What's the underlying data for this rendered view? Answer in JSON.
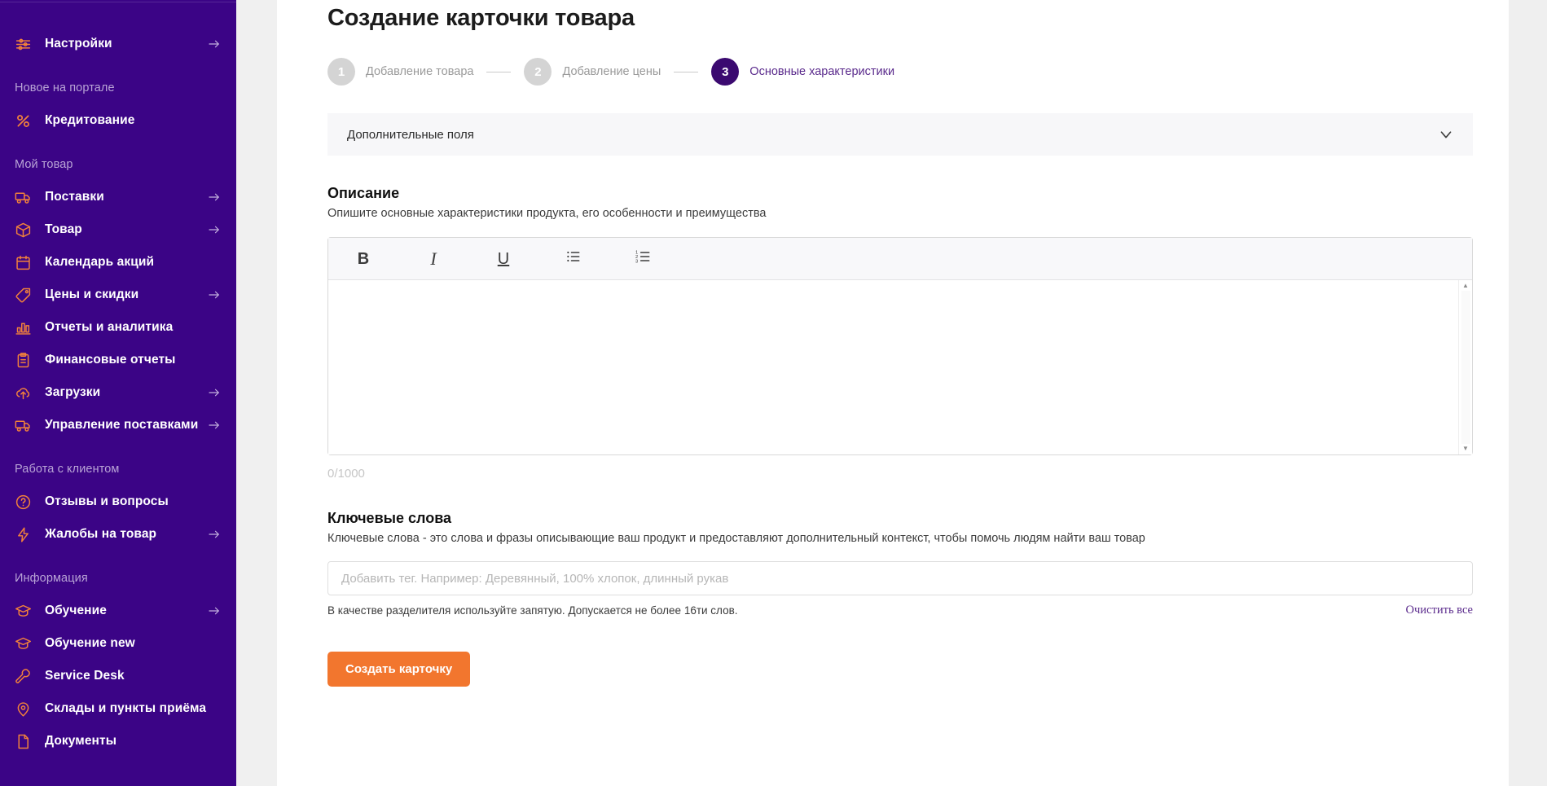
{
  "sidebar": {
    "groups": [
      {
        "title": "",
        "items": [
          {
            "label": "Настройки",
            "icon": "sliders-icon",
            "arrow": true
          }
        ]
      },
      {
        "title": "Новое на портале",
        "items": [
          {
            "label": "Кредитование",
            "icon": "percent-icon",
            "arrow": false
          }
        ]
      },
      {
        "title": "Мой товар",
        "items": [
          {
            "label": "Поставки",
            "icon": "truck-icon",
            "arrow": true
          },
          {
            "label": "Товар",
            "icon": "box-icon",
            "arrow": true
          },
          {
            "label": "Календарь акций",
            "icon": "calendar-icon",
            "arrow": false
          },
          {
            "label": "Цены и скидки",
            "icon": "tag-icon",
            "arrow": true
          },
          {
            "label": "Отчеты и аналитика",
            "icon": "bar-chart-icon",
            "arrow": false
          },
          {
            "label": "Финансовые отчеты",
            "icon": "clipboard-icon",
            "arrow": false
          },
          {
            "label": "Загрузки",
            "icon": "cloud-upload-icon",
            "arrow": true
          },
          {
            "label": "Управление поставками",
            "icon": "truck-icon",
            "arrow": true
          }
        ]
      },
      {
        "title": "Работа с клиентом",
        "items": [
          {
            "label": "Отзывы и вопросы",
            "icon": "question-circle-icon",
            "arrow": false
          },
          {
            "label": "Жалобы на товар",
            "icon": "bolt-icon",
            "arrow": true
          }
        ]
      },
      {
        "title": "Информация",
        "items": [
          {
            "label": "Обучение",
            "icon": "graduation-cap-icon",
            "arrow": true
          },
          {
            "label": "Обучение new",
            "icon": "graduation-cap-icon",
            "arrow": false
          },
          {
            "label": "Service Desk",
            "icon": "wrench-icon",
            "arrow": false
          },
          {
            "label": "Склады и пункты приёма",
            "icon": "map-pin-icon",
            "arrow": false
          },
          {
            "label": "Документы",
            "icon": "document-icon",
            "arrow": false
          }
        ]
      }
    ]
  },
  "page": {
    "title": "Создание карточки товара"
  },
  "steps": [
    {
      "number": "1",
      "label": "Добавление товара",
      "active": false
    },
    {
      "number": "2",
      "label": "Добавление цены",
      "active": false
    },
    {
      "number": "3",
      "label": "Основные характеристики",
      "active": true
    }
  ],
  "accordion": {
    "title": "Дополнительные поля"
  },
  "description": {
    "title": "Описание",
    "subtitle": "Опишите основные характеристики продукта, его особенности и преимущества",
    "toolbar": [
      {
        "name": "bold",
        "glyph": "B"
      },
      {
        "name": "italic",
        "glyph": "I"
      },
      {
        "name": "underline",
        "glyph": "U"
      },
      {
        "name": "bulleted-list",
        "glyph": ""
      },
      {
        "name": "numbered-list",
        "glyph": ""
      }
    ],
    "value": "",
    "placeholder": "",
    "counter": "0/1000"
  },
  "keywords": {
    "title": "Ключевые слова",
    "subtitle": "Ключевые слова - это слова и фразы описывающие ваш продукт и предоставляют дополнительный контекст, чтобы помочь людям найти ваш товар",
    "input_value": "",
    "input_placeholder": "Добавить тег. Например: Деревянный, 100% хлопок, длинный рукав",
    "hint": "В качестве разделителя используйте запятую. Допускается не более 16ти слов.",
    "clear_all": "Очистить все"
  },
  "submit": {
    "label": "Создать карточку"
  },
  "colors": {
    "sidebar_bg": "#3B0486",
    "sidebar_icon": "#F2813B",
    "accent_orange": "#F2762E",
    "step_active": "#3B0A70",
    "step_inactive": "#d4d4d4",
    "link_purple": "#5A2A8C"
  }
}
